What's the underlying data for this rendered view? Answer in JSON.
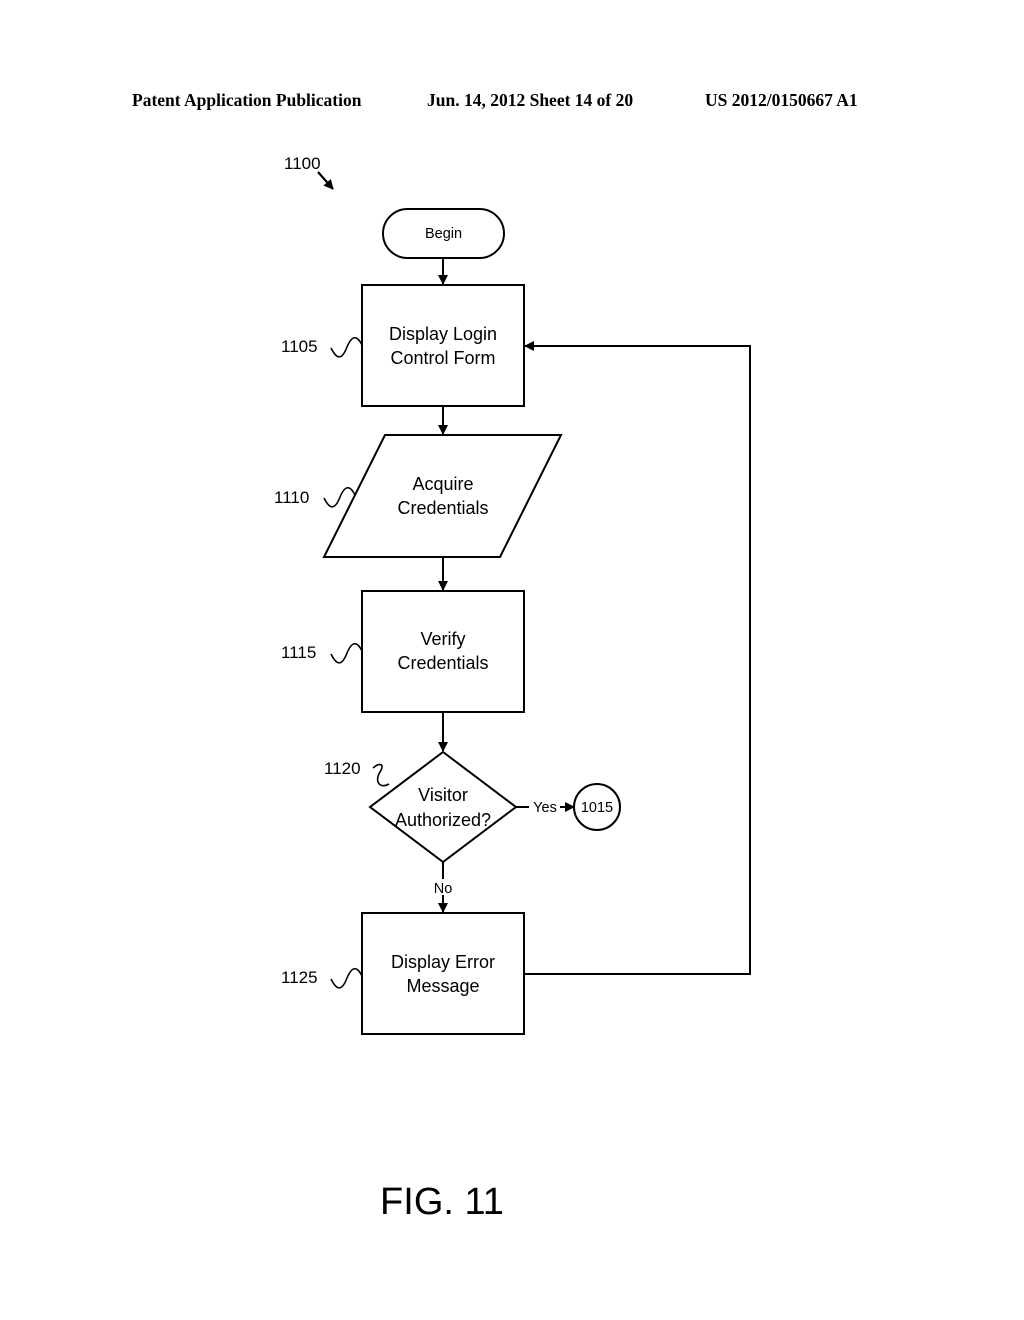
{
  "header": {
    "publication": "Patent Application Publication",
    "date_sheet": "Jun. 14, 2012  Sheet 14 of 20",
    "number": "US 2012/0150667 A1"
  },
  "diagram": {
    "ref": "1100",
    "nodes": [
      {
        "id": "begin",
        "type": "terminator",
        "lines": [
          "Begin"
        ]
      },
      {
        "id": "1105",
        "type": "process",
        "ref": "1105",
        "lines": [
          "Display Login",
          "Control Form"
        ]
      },
      {
        "id": "1110",
        "type": "io",
        "ref": "1110",
        "lines": [
          "Acquire",
          "Credentials"
        ]
      },
      {
        "id": "1115",
        "type": "process",
        "ref": "1115",
        "lines": [
          "Verify",
          "Credentials"
        ]
      },
      {
        "id": "1120",
        "type": "decision",
        "ref": "1120",
        "lines": [
          "Visitor",
          "Authorized?"
        ]
      },
      {
        "id": "1015",
        "type": "connector",
        "lines": [
          "1015"
        ]
      },
      {
        "id": "1125",
        "type": "process",
        "ref": "1125",
        "lines": [
          "Display Error",
          "Message"
        ]
      }
    ],
    "edges": [
      {
        "from": "begin",
        "to": "1105"
      },
      {
        "from": "1105",
        "to": "1110"
      },
      {
        "from": "1110",
        "to": "1115"
      },
      {
        "from": "1115",
        "to": "1120"
      },
      {
        "from": "1120",
        "to": "1015",
        "label": "Yes"
      },
      {
        "from": "1120",
        "to": "1125",
        "label": "No"
      },
      {
        "from": "1125",
        "to": "1105"
      }
    ],
    "caption": "FIG. 11"
  }
}
